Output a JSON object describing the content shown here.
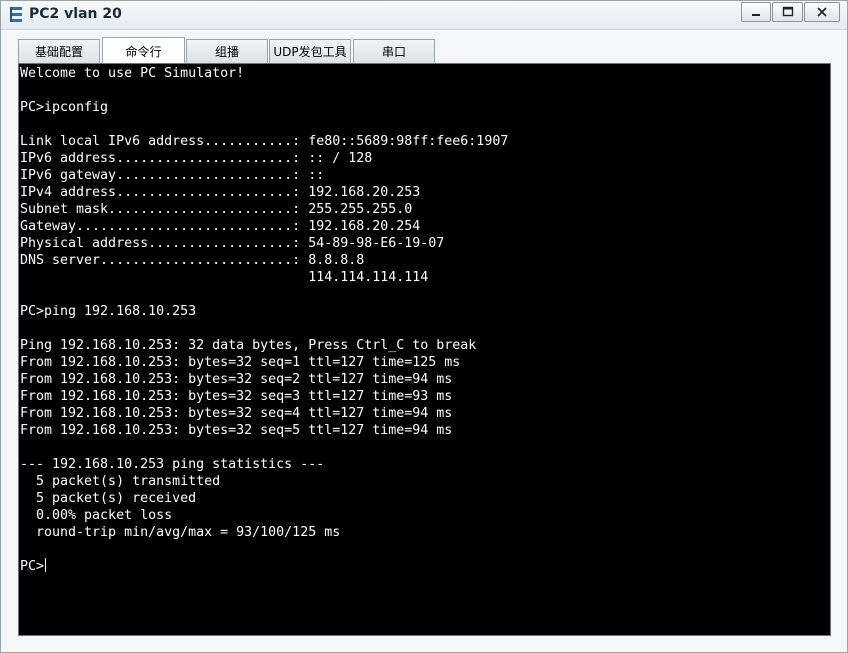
{
  "window": {
    "title": "PC2 vlan 20",
    "controls": [
      "minimize-icon",
      "maximize-icon",
      "close-icon"
    ]
  },
  "tabs": [
    {
      "label": "基础配置",
      "active": false
    },
    {
      "label": "命令行",
      "active": true
    },
    {
      "label": "组播",
      "active": false
    },
    {
      "label": "UDP发包工具",
      "active": false
    },
    {
      "label": "串口",
      "active": false
    }
  ],
  "terminal": {
    "lines": [
      "Welcome to use PC Simulator!",
      "",
      "PC>ipconfig",
      "",
      "Link local IPv6 address...........: fe80::5689:98ff:fee6:1907",
      "IPv6 address......................: :: / 128",
      "IPv6 gateway......................: ::",
      "IPv4 address......................: 192.168.20.253",
      "Subnet mask.......................: 255.255.255.0",
      "Gateway...........................: 192.168.20.254",
      "Physical address..................: 54-89-98-E6-19-07",
      "DNS server........................: 8.8.8.8",
      "                                    114.114.114.114",
      "",
      "PC>ping 192.168.10.253",
      "",
      "Ping 192.168.10.253: 32 data bytes, Press Ctrl_C to break",
      "From 192.168.10.253: bytes=32 seq=1 ttl=127 time=125 ms",
      "From 192.168.10.253: bytes=32 seq=2 ttl=127 time=94 ms",
      "From 192.168.10.253: bytes=32 seq=3 ttl=127 time=93 ms",
      "From 192.168.10.253: bytes=32 seq=4 ttl=127 time=94 ms",
      "From 192.168.10.253: bytes=32 seq=5 ttl=127 time=94 ms",
      "",
      "--- 192.168.10.253 ping statistics ---",
      "  5 packet(s) transmitted",
      "  5 packet(s) received",
      "  0.00% packet loss",
      "  round-trip min/avg/max = 93/100/125 ms",
      ""
    ],
    "prompt": "PC>"
  }
}
